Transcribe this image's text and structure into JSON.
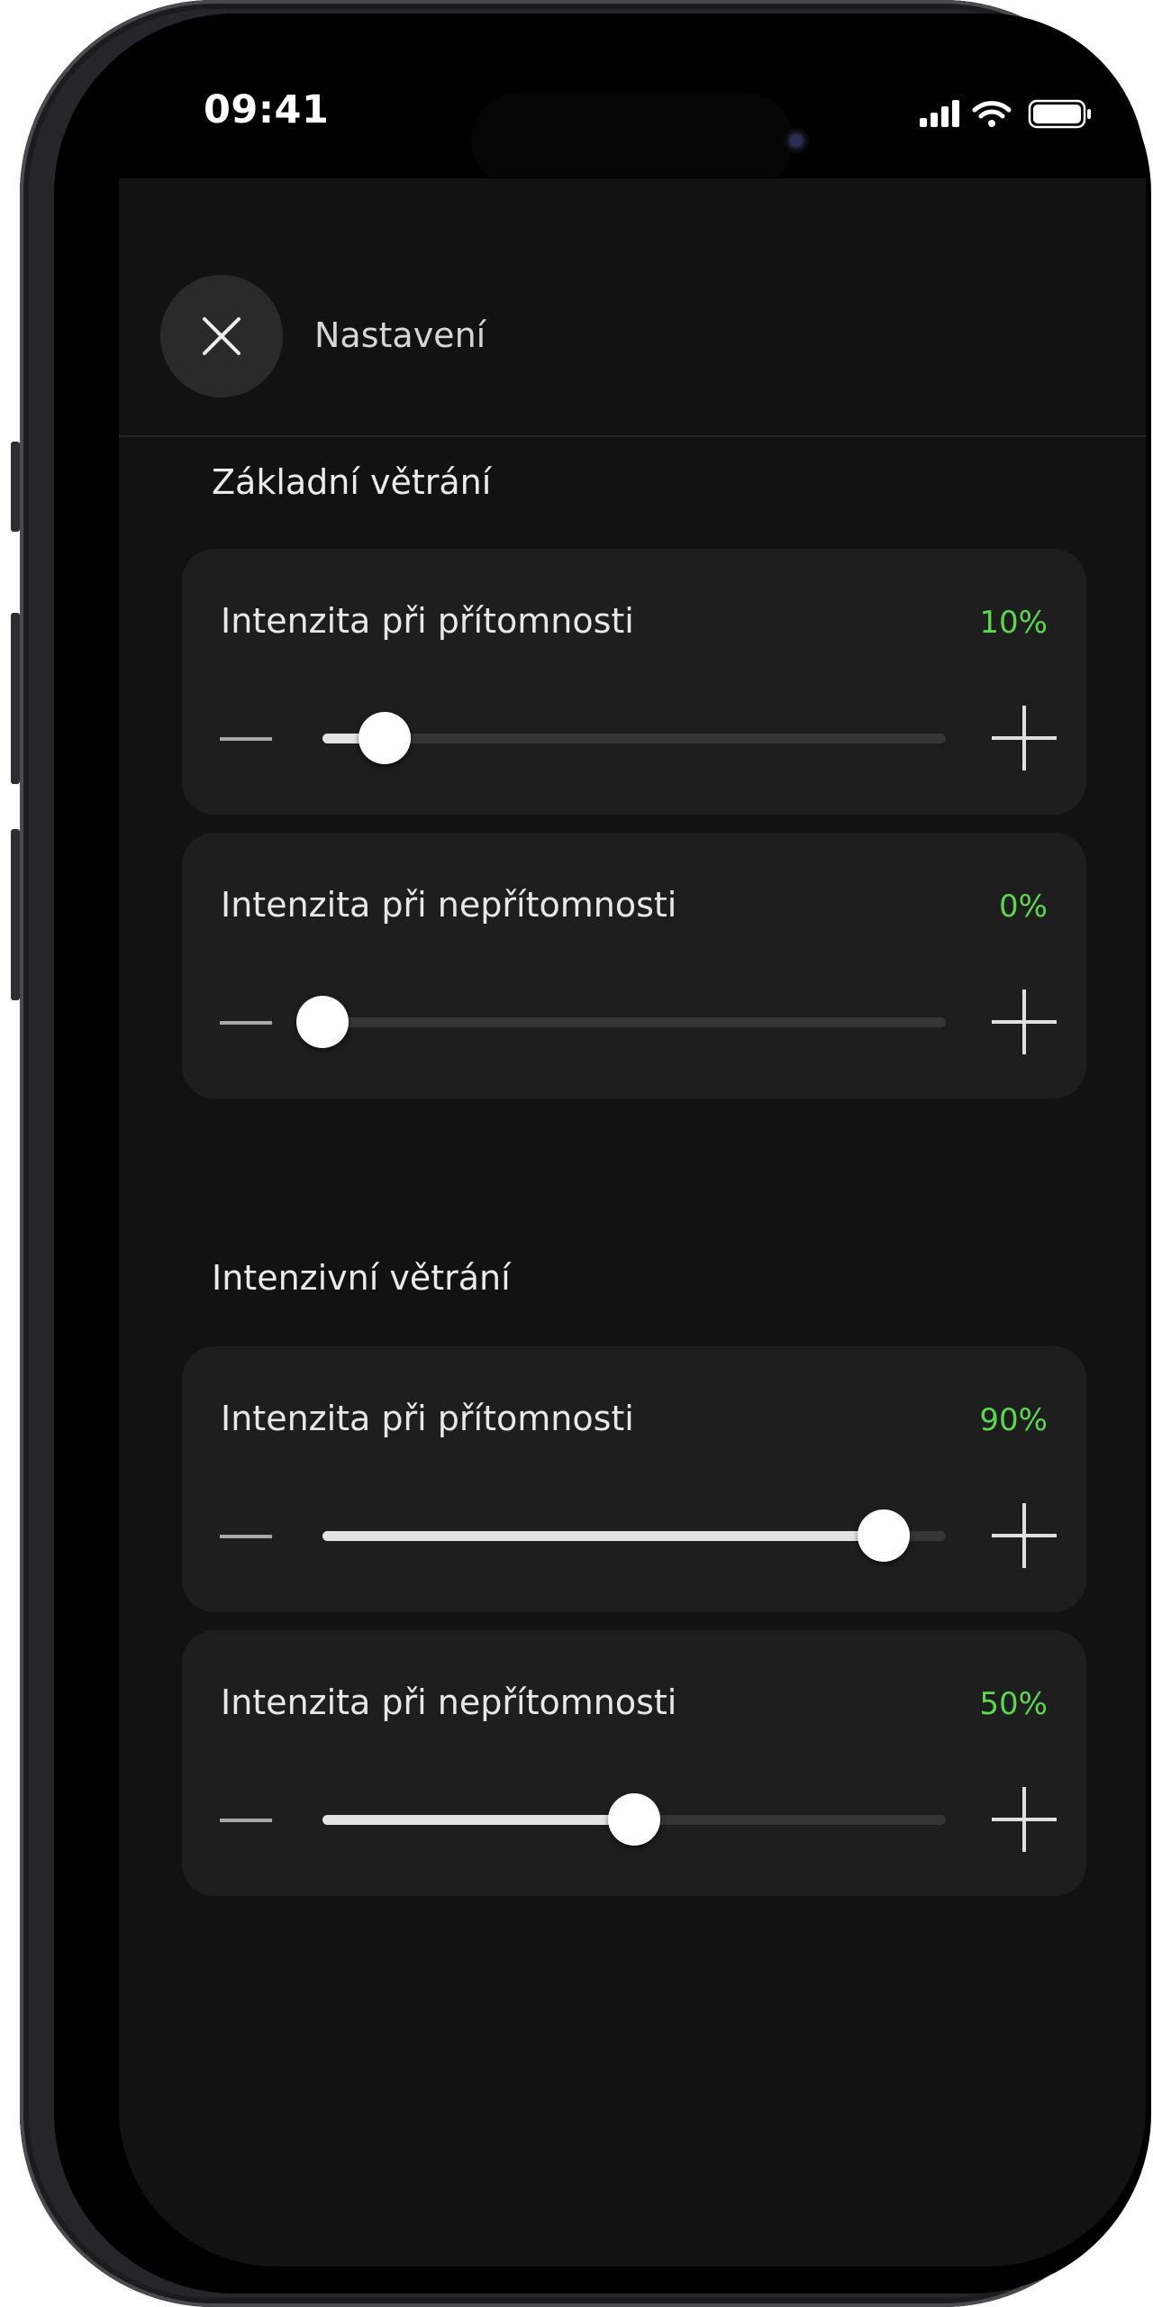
{
  "status_bar": {
    "time": "09:41",
    "icons": [
      "signal-icon",
      "wifi-icon",
      "battery-icon"
    ]
  },
  "header": {
    "title": "Nastavení",
    "close_icon": "close-icon"
  },
  "colors": {
    "accent": "#5cd651",
    "background": "#121212",
    "card": "#1e1e1e"
  },
  "sections": [
    {
      "title": "Základní větrání",
      "sliders": [
        {
          "label": "Intenzita při přítomnosti",
          "value_text": "10%",
          "value": 0.1
        },
        {
          "label": "Intenzita při nepřítomnosti",
          "value_text": "0%",
          "value": 0.0
        }
      ]
    },
    {
      "title": "Intenzivní větrání",
      "sliders": [
        {
          "label": "Intenzita při přítomnosti",
          "value_text": "90%",
          "value": 0.9
        },
        {
          "label": "Intenzita při nepřítomnosti",
          "value_text": "50%",
          "value": 0.5
        }
      ]
    }
  ]
}
